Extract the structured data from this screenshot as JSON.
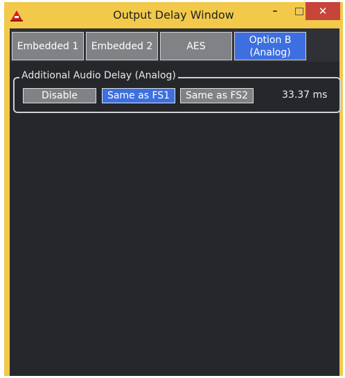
{
  "window": {
    "title": "Output Delay Window",
    "controls": {
      "minimize": "–",
      "close": "✕"
    }
  },
  "tabs": [
    {
      "label": "Embedded 1",
      "active": false
    },
    {
      "label": "Embedded 2",
      "active": false
    },
    {
      "label": "AES",
      "active": false
    },
    {
      "label": "Option B\n(Analog)",
      "active": true
    }
  ],
  "audio_delay": {
    "group_label": "Additional Audio Delay (Analog)",
    "options": [
      {
        "label": "Disable",
        "active": false
      },
      {
        "label": "Same as FS1",
        "active": true
      },
      {
        "label": "Same as FS2",
        "active": false
      }
    ],
    "value": "33.37 ms"
  },
  "colors": {
    "accent": "#3d6fe0",
    "titlebar": "#f2c94a",
    "close_button": "#c7443a",
    "background": "#25272b"
  },
  "icons": {
    "app": "app-logo-icon",
    "minimize": "minimize-icon",
    "maximize": "maximize-icon",
    "close": "close-icon"
  }
}
